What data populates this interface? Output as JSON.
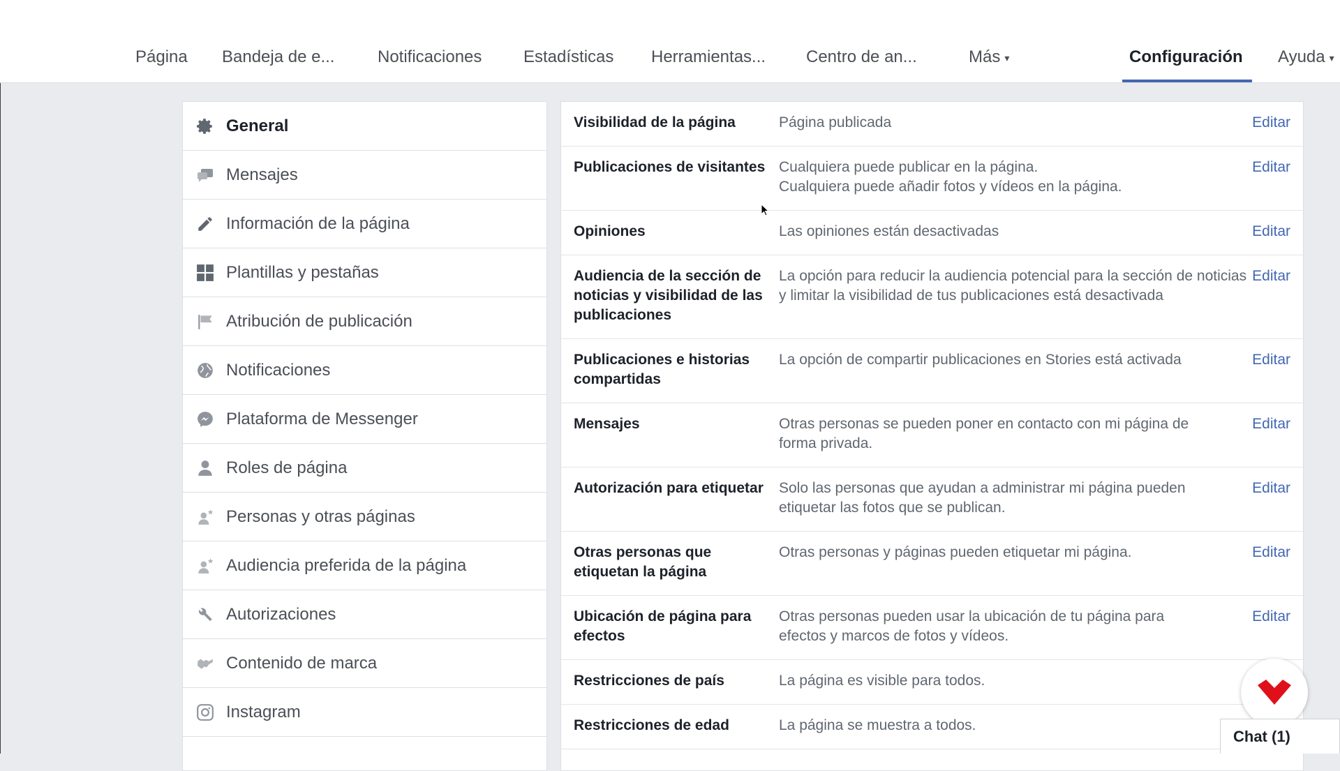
{
  "nav": {
    "items": [
      {
        "label": "Página"
      },
      {
        "label": "Bandeja de e..."
      },
      {
        "label": "Notificaciones"
      },
      {
        "label": "Estadísticas"
      },
      {
        "label": "Herramientas..."
      },
      {
        "label": "Centro de an..."
      },
      {
        "label": "Más"
      },
      {
        "label": "Configuración"
      },
      {
        "label": "Ayuda"
      }
    ],
    "active": "Configuración",
    "accent": "#4267b2"
  },
  "sidebar": {
    "items": [
      {
        "label": "General",
        "icon": "gear-icon"
      },
      {
        "label": "Mensajes",
        "icon": "message-icon"
      },
      {
        "label": "Información de la página",
        "icon": "pencil-icon"
      },
      {
        "label": "Plantillas y pestañas",
        "icon": "grid-icon"
      },
      {
        "label": "Atribución de publicación",
        "icon": "flag-icon"
      },
      {
        "label": "Notificaciones",
        "icon": "globe-icon"
      },
      {
        "label": "Plataforma de Messenger",
        "icon": "messenger-icon"
      },
      {
        "label": "Roles de página",
        "icon": "person-icon"
      },
      {
        "label": "Personas y otras páginas",
        "icon": "person-star-icon"
      },
      {
        "label": "Audiencia preferida de la página",
        "icon": "person-star-icon"
      },
      {
        "label": "Autorizaciones",
        "icon": "wrench-icon"
      },
      {
        "label": "Contenido de marca",
        "icon": "handshake-icon"
      },
      {
        "label": "Instagram",
        "icon": "instagram-icon"
      }
    ],
    "active": "General"
  },
  "settings": {
    "edit_label": "Editar",
    "rows": [
      {
        "key": "Visibilidad de la página",
        "value": "Página publicada"
      },
      {
        "key": "Publicaciones de visitantes",
        "value": "Cualquiera puede publicar en la página.\nCualquiera puede añadir fotos y vídeos en la página."
      },
      {
        "key": "Opiniones",
        "value": "Las opiniones están desactivadas"
      },
      {
        "key": "Audiencia de la sección de noticias y visibilidad de las publicaciones",
        "value": "La opción para reducir la audiencia potencial para la sección de noticias y limitar la visibilidad de tus publicaciones está desactivada"
      },
      {
        "key": "Publicaciones e historias compartidas",
        "value": "La opción de compartir publicaciones en Stories está activada"
      },
      {
        "key": "Mensajes",
        "value": "Otras personas se pueden poner en contacto con mi página de forma privada."
      },
      {
        "key": "Autorización para etiquetar",
        "value": "Solo las personas que ayudan a administrar mi página pueden etiquetar las fotos que se publican."
      },
      {
        "key": "Otras personas que etiquetan la página",
        "value": "Otras personas y páginas pueden etiquetar mi página."
      },
      {
        "key": "Ubicación de página para efectos",
        "value": "Otras personas pueden usar la ubicación de tu página para efectos y marcos de fotos y vídeos."
      },
      {
        "key": "Restricciones de país",
        "value": "La página es visible para todos."
      },
      {
        "key": "Restricciones de edad",
        "value": "La página se muestra a todos."
      }
    ]
  },
  "chat": {
    "label": "Chat (1)"
  },
  "brand_color": "#e0101a"
}
